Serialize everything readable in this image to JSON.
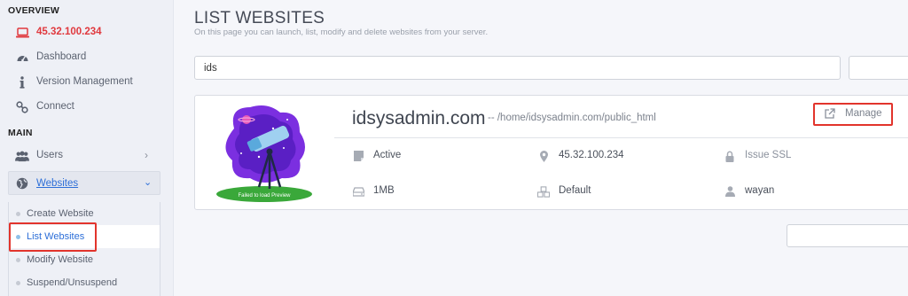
{
  "sidebar": {
    "overview_heading": "OVERVIEW",
    "main_heading": "MAIN",
    "ip": "45.32.100.234",
    "items": [
      {
        "label": "Dashboard",
        "icon": "dashboard-icon"
      },
      {
        "label": "Version Management",
        "icon": "info-icon"
      },
      {
        "label": "Connect",
        "icon": "link-icon"
      }
    ],
    "users_label": "Users",
    "websites_label": "Websites",
    "submenu": [
      {
        "label": "Create Website"
      },
      {
        "label": "List Websites"
      },
      {
        "label": "Modify Website"
      },
      {
        "label": "Suspend/Unsuspend"
      }
    ]
  },
  "page": {
    "title": "LIST WEBSITES",
    "subtitle": "On this page you can launch, list, modify and delete websites from your server."
  },
  "search": {
    "value": "ids"
  },
  "website": {
    "domain": "idsysadmin.com",
    "path": "-- /home/idsysadmin.com/public_html",
    "manage_label": "Manage",
    "preview_caption": "Failed to load Preview",
    "status": "Active",
    "ip": "45.32.100.234",
    "ssl": "Issue SSL",
    "disk": "1MB",
    "package": "Default",
    "owner": "wayan"
  },
  "colors": {
    "accent": "#2c6ed8",
    "ip_red": "#e0393e",
    "highlight": "#e2342c"
  }
}
